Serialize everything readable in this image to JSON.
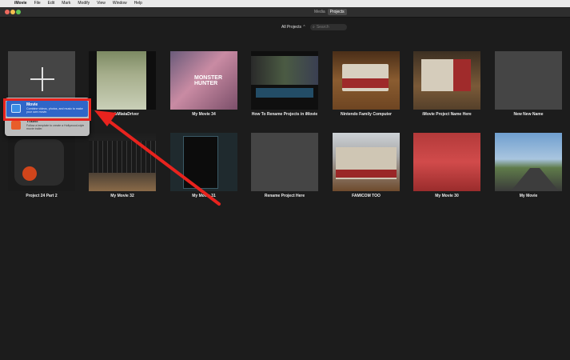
{
  "menubar": {
    "apple_glyph": "",
    "items": [
      "iMovie",
      "File",
      "Edit",
      "Mark",
      "Modify",
      "View",
      "Window",
      "Help"
    ]
  },
  "titlebar": {
    "segments": [
      {
        "label": "Media",
        "active": false
      },
      {
        "label": "Projects",
        "active": true
      }
    ]
  },
  "toolbar": {
    "filter_label": "All Projects ⌃",
    "search_icon": "⌕",
    "search_placeholder": "Search"
  },
  "projects": [
    {
      "title": "",
      "kind": "new"
    },
    {
      "title": "DumbMiataDriver"
    },
    {
      "title": "My Movie 34"
    },
    {
      "title": "How To Rename Projects in iMovie"
    },
    {
      "title": "Nintendo Family Computer"
    },
    {
      "title": "iMovie Project Name Here"
    },
    {
      "title": "New New Name"
    },
    {
      "title": "Project 24 Part 2"
    },
    {
      "title": "My Movie 32"
    },
    {
      "title": "My Movie 31"
    },
    {
      "title": "Rename Project Here"
    },
    {
      "title": "FAMICOM TOO"
    },
    {
      "title": "My Movie 30"
    },
    {
      "title": "My Movie"
    }
  ],
  "popup": {
    "movie": {
      "label": "Movie",
      "description": "Combine videos, photos, and music to make your own movie."
    },
    "trailer": {
      "label": "Trailer",
      "description": "Follow a template to create a Hollywood-style movie trailer."
    }
  },
  "thumbnail_text": {
    "my_movie_34": "MONSTER HUNTER"
  },
  "colors": {
    "annotation_red": "#e8231e",
    "menu_selection_blue": "#2f66c8",
    "window_background": "#1c1c1c"
  }
}
